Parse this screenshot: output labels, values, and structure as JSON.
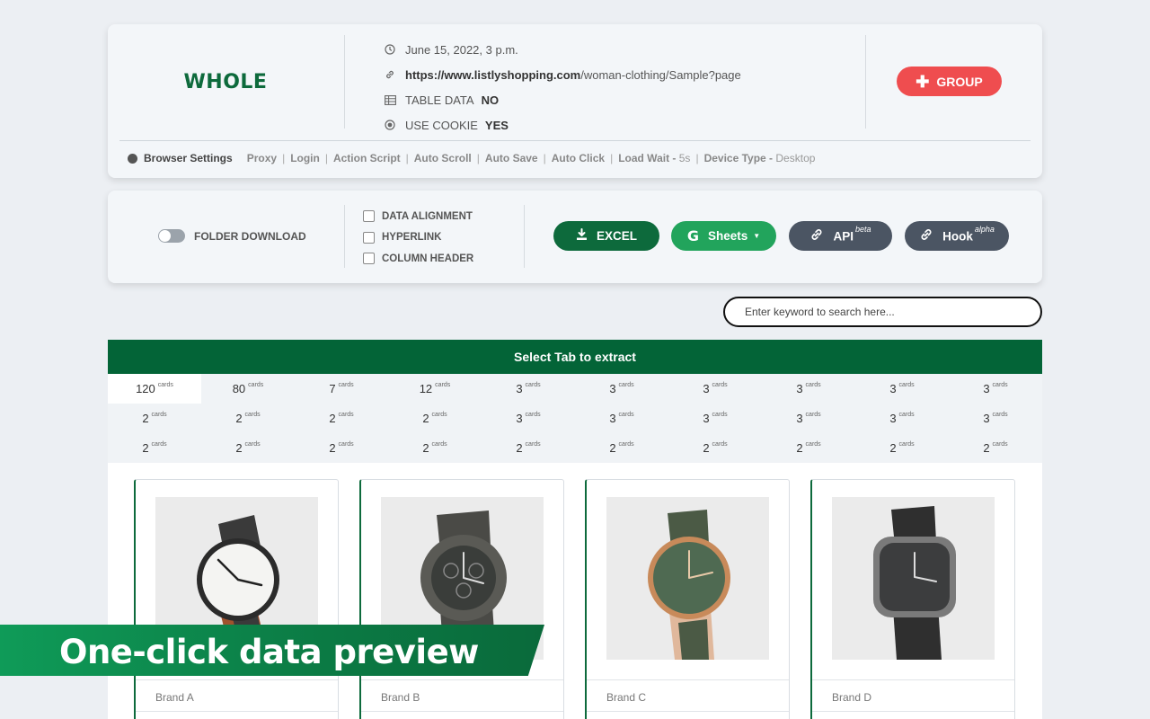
{
  "info": {
    "logo_text": "WHOLE",
    "datetime": "June 15, 2022, 3 p.m.",
    "url_bold": "https://www.listlyshopping.com",
    "url_rest": "/woman-clothing/Sample?page",
    "table_data_label": "TABLE DATA",
    "table_data_value": "NO",
    "use_cookie_label": "USE COOKIE",
    "use_cookie_value": "YES",
    "group_button": "GROUP"
  },
  "browser_settings": {
    "title": "Browser Settings",
    "proxy": "Proxy",
    "login": "Login",
    "action_script": "Action Script",
    "auto_scroll": "Auto Scroll",
    "auto_save": "Auto Save",
    "auto_click": "Auto Click",
    "load_wait": "Load Wait -",
    "load_wait_value": "5s",
    "device_type": "Device Type -",
    "device_type_value": "Desktop"
  },
  "options": {
    "folder_download": "FOLDER DOWNLOAD",
    "data_alignment": "DATA ALIGNMENT",
    "hyperlink": "HYPERLINK",
    "column_header": "COLUMN HEADER",
    "excel": "EXCEL",
    "sheets": "Sheets",
    "api": "API",
    "api_sup": "beta",
    "hook": "Hook",
    "hook_sup": "alpha"
  },
  "search": {
    "placeholder": "Enter keyword to search here..."
  },
  "tabs": {
    "header": "Select Tab to extract",
    "unit": "cards",
    "rows": [
      [
        "120",
        "80",
        "7",
        "12",
        "3",
        "3",
        "3",
        "3",
        "3",
        "3"
      ],
      [
        "2",
        "2",
        "2",
        "2",
        "3",
        "3",
        "3",
        "3",
        "3",
        "3"
      ],
      [
        "2",
        "2",
        "2",
        "2",
        "2",
        "2",
        "2",
        "2",
        "2",
        "2"
      ]
    ]
  },
  "cards": [
    {
      "brand": "Brand A"
    },
    {
      "brand": "Brand B"
    },
    {
      "brand": "Brand C"
    },
    {
      "brand": "Brand D"
    }
  ],
  "banner": {
    "text": "One-click data preview"
  },
  "colors": {
    "brand_green": "#0d6a3c",
    "sheets_green": "#22a45c",
    "group_red": "#ef4d4f",
    "slate": "#4b5563"
  }
}
